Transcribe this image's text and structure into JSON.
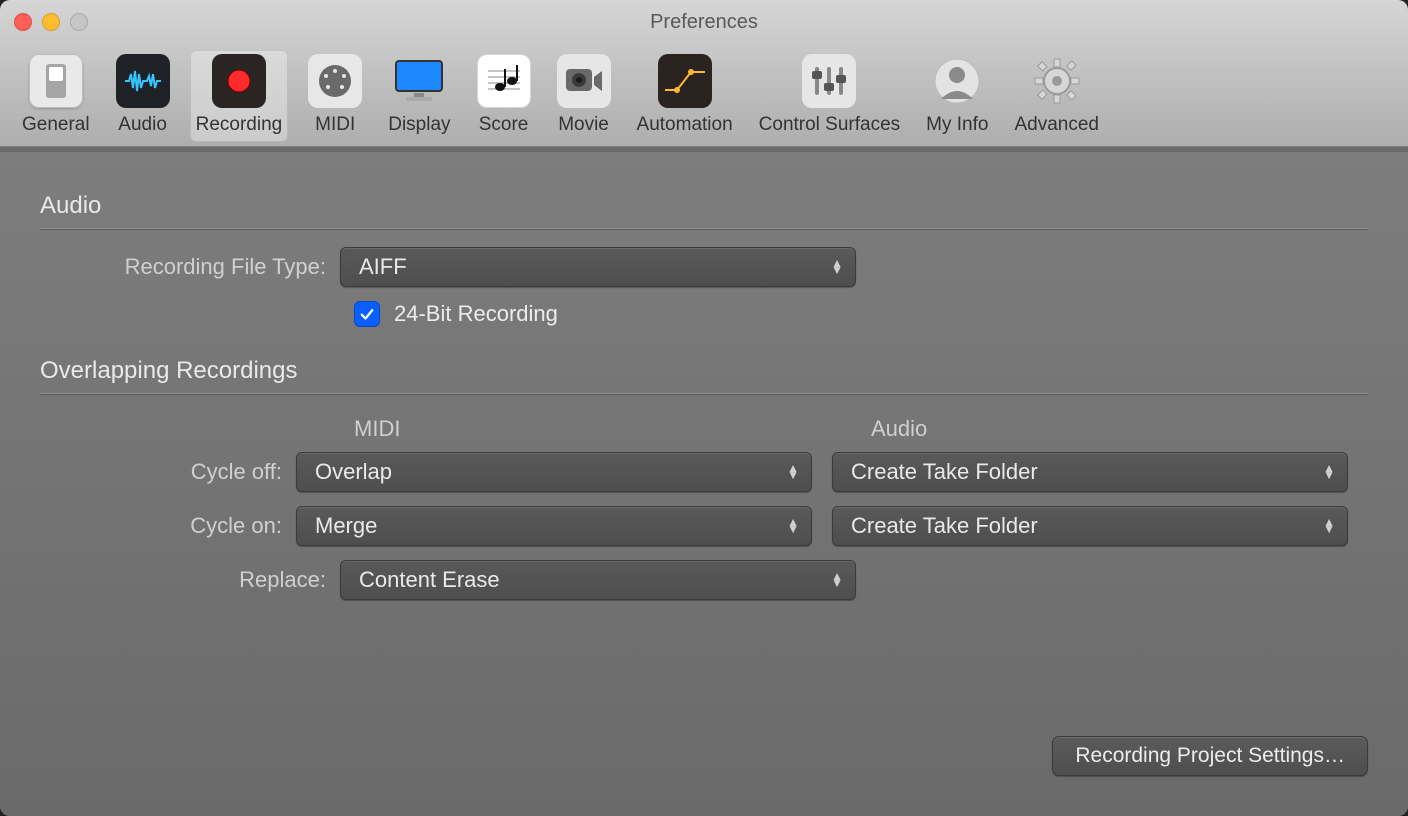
{
  "window": {
    "title": "Preferences"
  },
  "toolbar": {
    "items": [
      {
        "label": "General"
      },
      {
        "label": "Audio"
      },
      {
        "label": "Recording"
      },
      {
        "label": "MIDI"
      },
      {
        "label": "Display"
      },
      {
        "label": "Score"
      },
      {
        "label": "Movie"
      },
      {
        "label": "Automation"
      },
      {
        "label": "Control Surfaces"
      },
      {
        "label": "My Info"
      },
      {
        "label": "Advanced"
      }
    ],
    "selected_index": 2
  },
  "sections": {
    "audio": {
      "title": "Audio",
      "recording_file_type": {
        "label": "Recording File Type:",
        "value": "AIFF"
      },
      "bit24": {
        "checked": true,
        "label": "24-Bit Recording"
      }
    },
    "overlap": {
      "title": "Overlapping Recordings",
      "col_midi": "MIDI",
      "col_audio": "Audio",
      "rows": {
        "cycle_off": {
          "label": "Cycle off:",
          "midi": "Overlap",
          "audio": "Create Take Folder"
        },
        "cycle_on": {
          "label": "Cycle on:",
          "midi": "Merge",
          "audio": "Create Take Folder"
        },
        "replace": {
          "label": "Replace:",
          "midi": "Content Erase"
        }
      }
    }
  },
  "footer": {
    "button": "Recording Project Settings…"
  }
}
